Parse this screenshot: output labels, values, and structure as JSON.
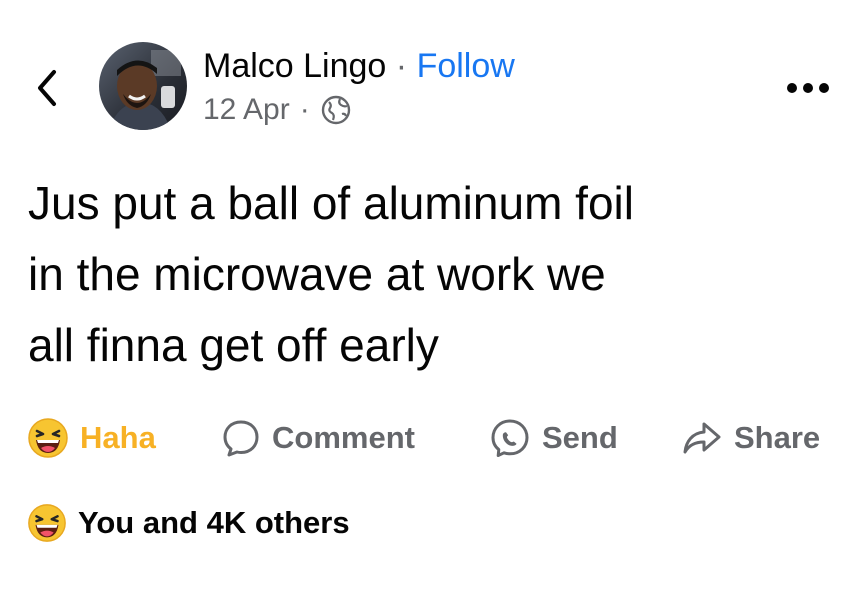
{
  "header": {
    "author": "Malco Lingo",
    "separator": "·",
    "follow_label": "Follow",
    "date": "12 Apr",
    "meta_separator": "·",
    "icons": [
      "back-chevron-icon",
      "avatar",
      "globe-icon",
      "more-dots-icon"
    ]
  },
  "post": {
    "lines": [
      "Jus put a ball of aluminum foil",
      "in the microwave at work we",
      "all finna get off early"
    ]
  },
  "actions": {
    "haha": {
      "label": "Haha",
      "icon": "haha-emoji-icon",
      "color": "#f7b125"
    },
    "comment": {
      "label": "Comment",
      "icon": "comment-bubble-icon"
    },
    "send": {
      "label": "Send",
      "icon": "messenger-icon"
    },
    "share": {
      "label": "Share",
      "icon": "share-arrow-icon"
    }
  },
  "reactions": {
    "summary": "You and 4K others",
    "icon": "haha-emoji-icon"
  },
  "colors": {
    "text": "#050505",
    "secondary": "#65676b",
    "link": "#1877f2",
    "haha": "#f7b125"
  }
}
